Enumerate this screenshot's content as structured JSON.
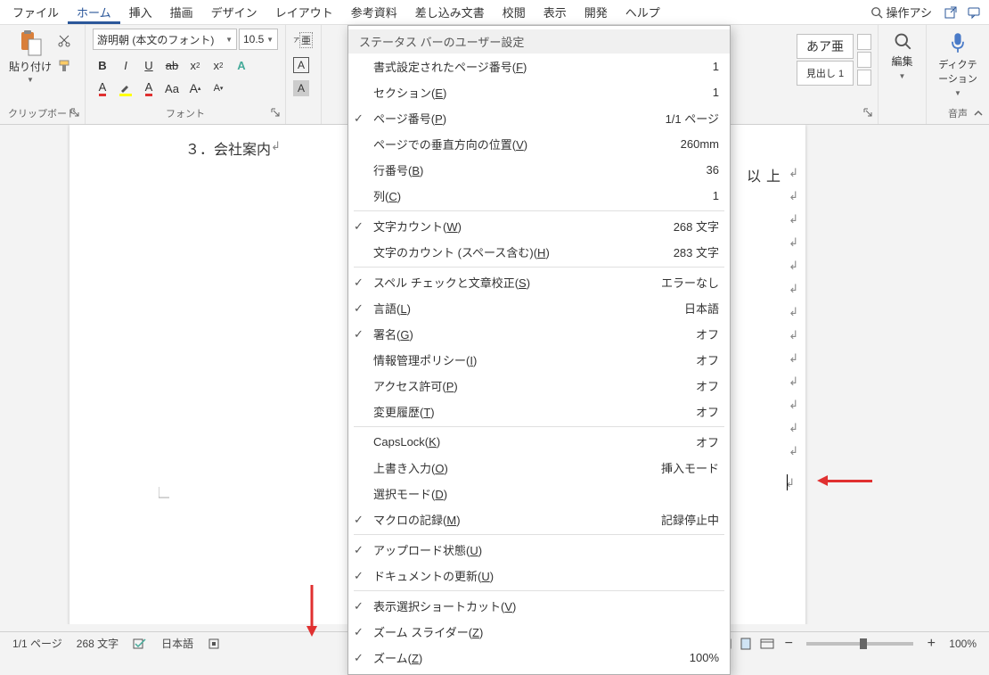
{
  "menubar": {
    "items": [
      "ファイル",
      "ホーム",
      "挿入",
      "描画",
      "デザイン",
      "レイアウト",
      "参考資料",
      "差し込み文書",
      "校閲",
      "表示",
      "開発",
      "ヘルプ"
    ],
    "active_index": 1,
    "search_label": "操作アシ"
  },
  "ribbon": {
    "clipboard": {
      "label": "クリップボード",
      "paste": "貼り付け"
    },
    "font": {
      "label": "フォント",
      "name": "游明朝 (本文のフォント)",
      "size": "10.5"
    },
    "styles": {
      "normal_preview": "あア亜",
      "heading1": "見出し 1"
    },
    "editing": {
      "label": "編集"
    },
    "voice": {
      "label": "音声",
      "dictation": "ディクテーション"
    }
  },
  "document": {
    "line_text": "３．会社案内",
    "end_text": "以上"
  },
  "statusbar": {
    "page": "1/1 ページ",
    "words": "268 文字",
    "language": "日本語",
    "zoom": "100%"
  },
  "context_menu": {
    "title": "ステータス バーのユーザー設定",
    "items": [
      {
        "checked": false,
        "label_pre": "書式設定されたページ番号(",
        "key": "F",
        "label_post": ")",
        "value": "1"
      },
      {
        "checked": false,
        "label_pre": "セクション(",
        "key": "E",
        "label_post": ")",
        "value": "1"
      },
      {
        "checked": true,
        "label_pre": "ページ番号(",
        "key": "P",
        "label_post": ")",
        "value": "1/1 ページ"
      },
      {
        "checked": false,
        "label_pre": "ページでの垂直方向の位置(",
        "key": "V",
        "label_post": ")",
        "value": "260mm"
      },
      {
        "checked": false,
        "label_pre": "行番号(",
        "key": "B",
        "label_post": ")",
        "value": "36",
        "highlight": true
      },
      {
        "checked": false,
        "label_pre": "列(",
        "key": "C",
        "label_post": ")",
        "value": "1"
      },
      {
        "divider": true
      },
      {
        "checked": true,
        "label_pre": "文字カウント(",
        "key": "W",
        "label_post": ")",
        "value": "268 文字"
      },
      {
        "checked": false,
        "label_pre": "文字のカウント (スペース含む)(",
        "key": "H",
        "label_post": ")",
        "value": "283 文字"
      },
      {
        "divider": true
      },
      {
        "checked": true,
        "label_pre": "スペル チェックと文章校正(",
        "key": "S",
        "label_post": ")",
        "value": "エラーなし"
      },
      {
        "checked": true,
        "label_pre": "言語(",
        "key": "L",
        "label_post": ")",
        "value": "日本語"
      },
      {
        "checked": true,
        "label_pre": "署名(",
        "key": "G",
        "label_post": ")",
        "value": "オフ"
      },
      {
        "checked": false,
        "label_pre": "情報管理ポリシー(",
        "key": "I",
        "label_post": ")",
        "value": "オフ"
      },
      {
        "checked": false,
        "label_pre": "アクセス許可(",
        "key": "P",
        "label_post": ")",
        "value": "オフ"
      },
      {
        "checked": false,
        "label_pre": "変更履歴(",
        "key": "T",
        "label_post": ")",
        "value": "オフ"
      },
      {
        "divider": true
      },
      {
        "checked": false,
        "label_pre": "CapsLock(",
        "key": "K",
        "label_post": ")",
        "value": "オフ"
      },
      {
        "checked": false,
        "label_pre": "上書き入力(",
        "key": "O",
        "label_post": ")",
        "value": "挿入モード"
      },
      {
        "checked": false,
        "label_pre": "選択モード(",
        "key": "D",
        "label_post": ")",
        "value": ""
      },
      {
        "checked": true,
        "label_pre": "マクロの記録(",
        "key": "M",
        "label_post": ")",
        "value": "記録停止中"
      },
      {
        "divider": true
      },
      {
        "checked": true,
        "label_pre": "アップロード状態(",
        "key": "U",
        "label_post": ")",
        "value": ""
      },
      {
        "checked": true,
        "label_pre": "ドキュメントの更新(",
        "key": "U",
        "label_post": ")",
        "value": ""
      },
      {
        "divider": true
      },
      {
        "checked": true,
        "label_pre": "表示選択ショートカット(",
        "key": "V",
        "label_post": ")",
        "value": ""
      },
      {
        "checked": true,
        "label_pre": "ズーム スライダー(",
        "key": "Z",
        "label_post": ")",
        "value": ""
      },
      {
        "checked": true,
        "label_pre": "ズーム(",
        "key": "Z",
        "label_post": ")",
        "value": "100%"
      }
    ]
  }
}
